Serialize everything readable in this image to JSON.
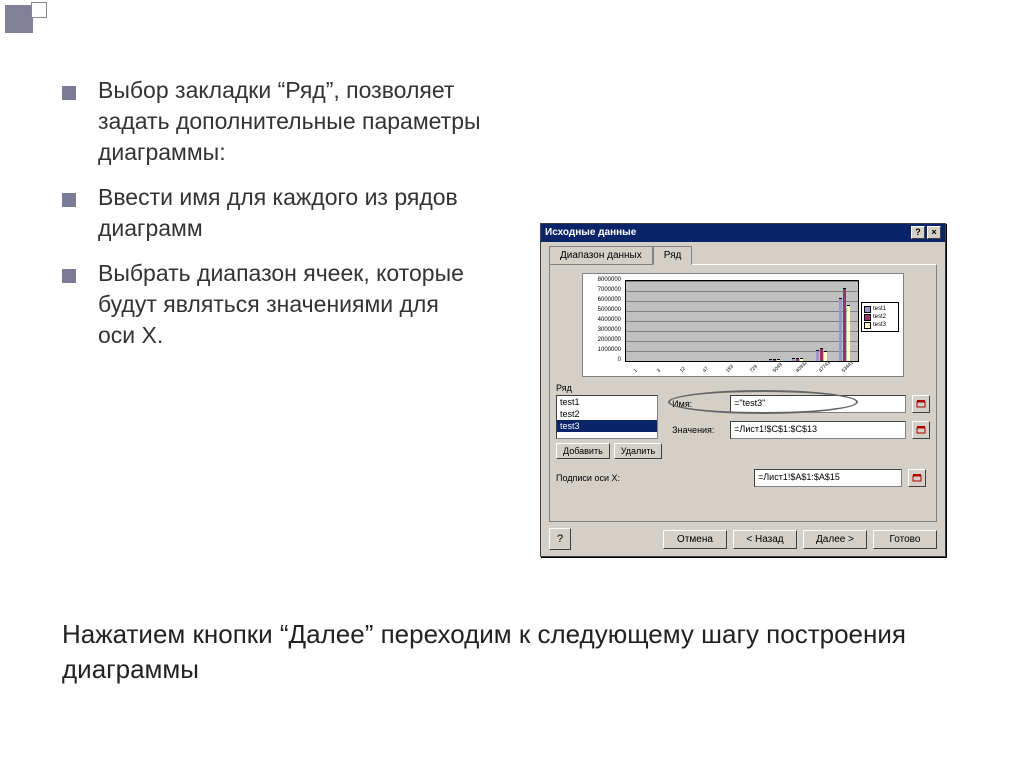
{
  "slide": {
    "bullets": [
      "Выбор закладки “Ряд”, позволяет задать дополнительные параметры диаграммы:",
      "Ввести имя для каждого из рядов диаграмм",
      "Выбрать диапазон ячеек, которые будут являться значениями для оси X."
    ],
    "footer_text": "Нажатием кнопки “Далее” переходим к следующему шагу построения диаграммы"
  },
  "dialog": {
    "title": "Исходные данные",
    "tabs": {
      "data_range": "Диапазон данных",
      "series": "Ряд"
    },
    "series_group_label": "Ряд",
    "series_items": [
      "test1",
      "test2",
      "test3"
    ],
    "series_selected": "test3",
    "add_btn": "Добавить",
    "remove_btn": "Удалить",
    "name_label": "Имя:",
    "name_value": "=\"test3\"",
    "values_label": "Значения:",
    "values_value": "=Лист1!$C$1:$C$13",
    "xlabels_label": "Подписи оси X:",
    "xlabels_value": "=Лист1!$A$1:$A$15",
    "help_icon": "?",
    "cancel": "Отмена",
    "back": "< Назад",
    "next": "Далее >",
    "finish": "Готово",
    "legend": [
      "test1",
      "test2",
      "test3"
    ],
    "legend_colors": [
      "#9999cc",
      "#993366",
      "#ffffcc"
    ]
  },
  "chart_data": {
    "type": "bar",
    "title": "",
    "xlabel": "",
    "ylabel": "",
    "ylim": [
      0,
      8000000
    ],
    "y_ticks": [
      0,
      1000000,
      2000000,
      3000000,
      4000000,
      5000000,
      6000000,
      7000000,
      8000000
    ],
    "categories": [
      "1",
      "3",
      "12",
      "47",
      "183",
      "729",
      "5049",
      "40932",
      "47743",
      "53441"
    ],
    "series": [
      {
        "name": "test1",
        "color": "#9999cc",
        "values": [
          0,
          0,
          0,
          0,
          0,
          0,
          80000,
          200000,
          1000000,
          6200000
        ]
      },
      {
        "name": "test2",
        "color": "#993366",
        "values": [
          0,
          0,
          0,
          0,
          0,
          0,
          90000,
          250000,
          1200000,
          7200000
        ]
      },
      {
        "name": "test3",
        "color": "#ffffcc",
        "values": [
          0,
          0,
          0,
          0,
          0,
          0,
          70000,
          180000,
          900000,
          5500000
        ]
      }
    ]
  }
}
